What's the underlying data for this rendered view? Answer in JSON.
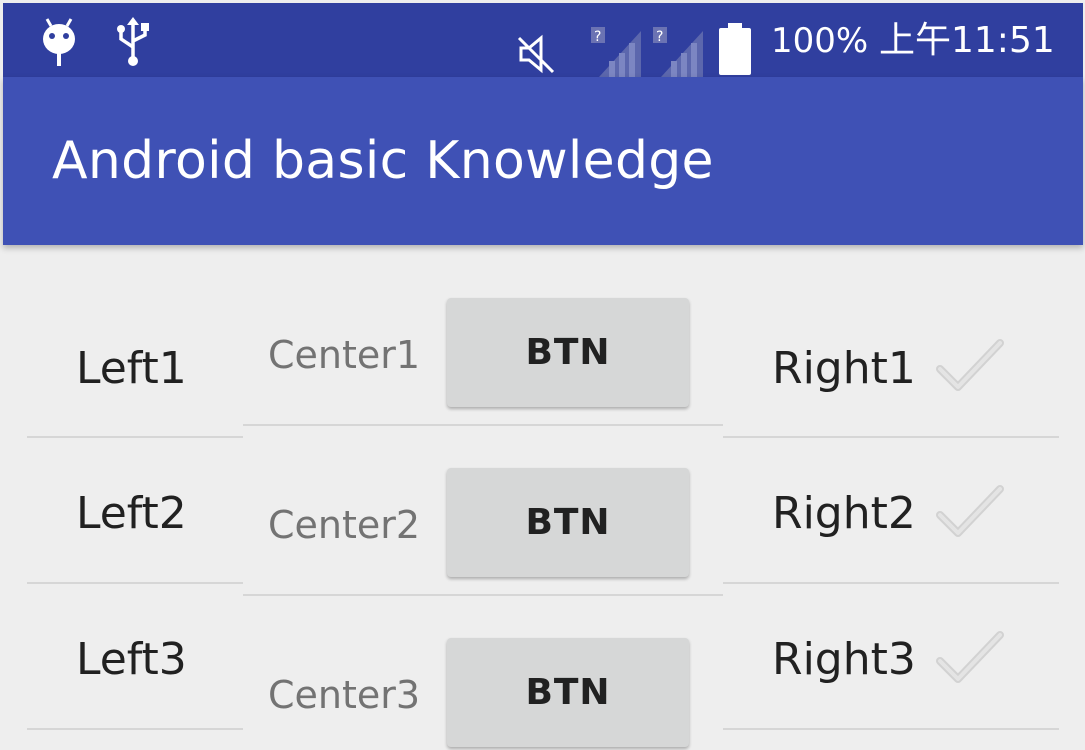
{
  "status_bar": {
    "battery_text": "100%",
    "time_text": "上午11:51",
    "icons": [
      "android-debug-icon",
      "usb-icon",
      "mute-icon",
      "signal-icon",
      "signal-icon",
      "battery-icon"
    ]
  },
  "app_bar": {
    "title": "Android basic Knowledge"
  },
  "rows": [
    {
      "left": "Left1",
      "center": "Center1",
      "button": "BTN",
      "right": "Right1",
      "checked": false
    },
    {
      "left": "Left2",
      "center": "Center2",
      "button": "BTN",
      "right": "Right2",
      "checked": false
    },
    {
      "left": "Left3",
      "center": "Center3",
      "button": "BTN",
      "right": "Right3",
      "checked": false
    }
  ],
  "colors": {
    "status_bar": "#303f9f",
    "app_bar": "#3f51b5",
    "background": "#eeeeee",
    "button": "#d6d7d7"
  }
}
